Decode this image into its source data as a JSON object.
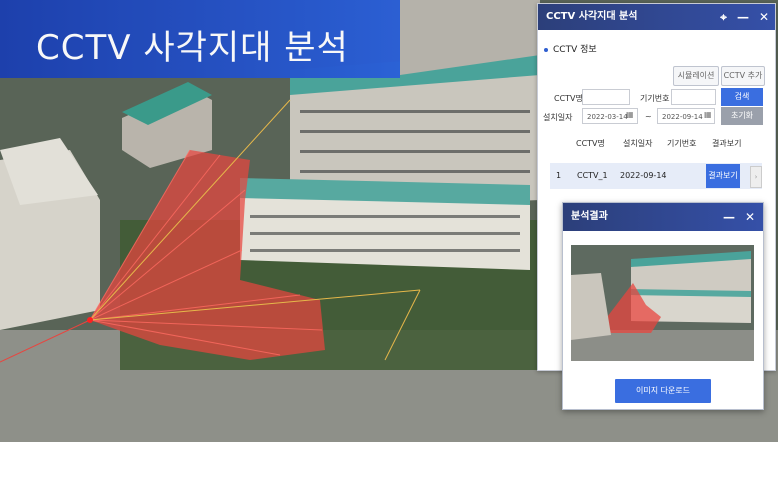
{
  "banner": {
    "title": "CCTV 사각지대 분석"
  },
  "panel": {
    "title": "CCTV 사각지대 분석",
    "icons": {
      "pin": "map-pin-icon",
      "minimize": "minimize-icon",
      "close": "close-icon"
    },
    "section": "CCTV 정보",
    "simulation_button": "시뮬레이션",
    "add_button": "CCTV 추가",
    "name_label": "CCTV명",
    "name_value": "",
    "device_label": "기기번호",
    "device_value": "",
    "date_label": "설치일자",
    "date_from": "2022-03-14",
    "date_sep": "~",
    "date_to": "2022-09-14",
    "search_button": "검색",
    "reset_button": "초기화",
    "table": {
      "headers": [
        "CCTV명",
        "설치일자",
        "기기번호",
        "결과보기"
      ],
      "rows": [
        {
          "no": "1",
          "name": "CCTV_1",
          "date": "2022-09-14",
          "device": "",
          "action": "결과보기"
        }
      ]
    }
  },
  "popup": {
    "title": "분석결과",
    "download_button": "이미지 다운로드"
  },
  "colors": {
    "accent": "#3a6ee0",
    "header": "#2c3f7a",
    "blindspot": "#e8453f"
  }
}
